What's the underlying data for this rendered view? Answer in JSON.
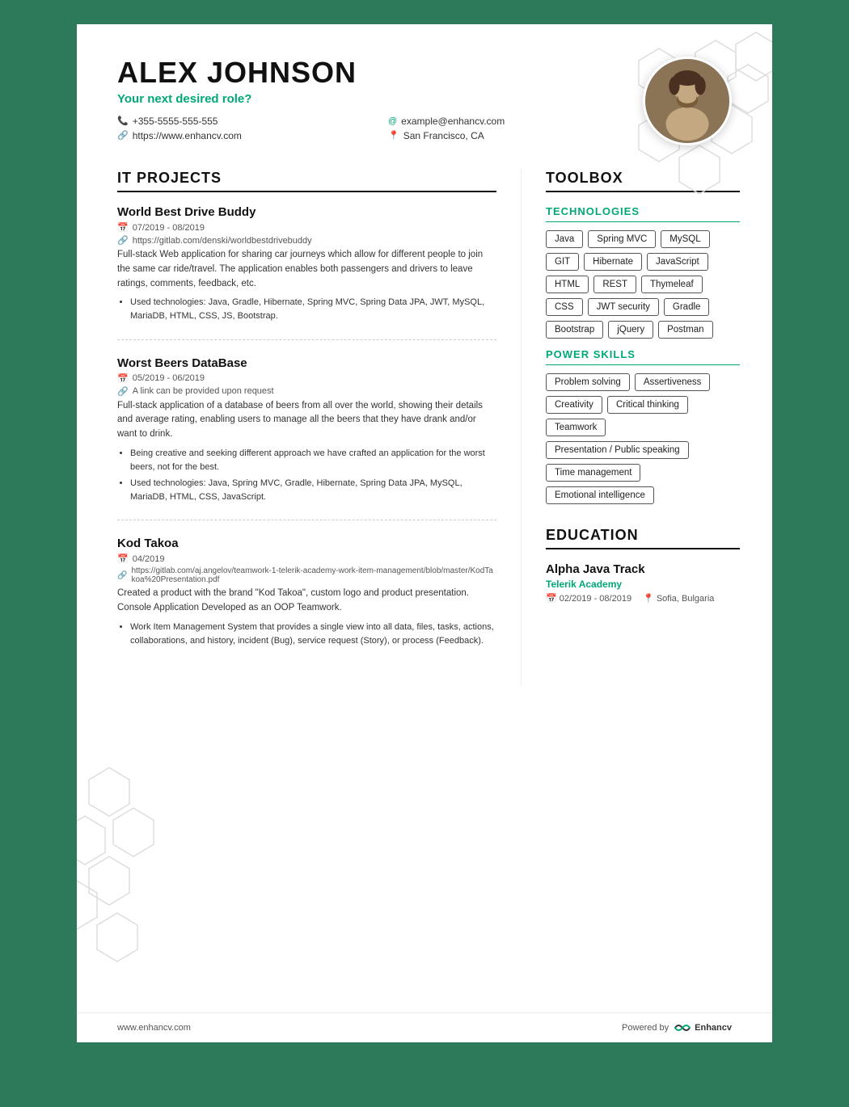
{
  "header": {
    "name": "ALEX JOHNSON",
    "role": "Your next desired role?",
    "phone": "+355-5555-555-555",
    "website": "https://www.enhancv.com",
    "email": "example@enhancv.com",
    "location": "San Francisco, CA"
  },
  "itProjects": {
    "sectionTitle": "IT PROJECTS",
    "projects": [
      {
        "title": "World Best Drive Buddy",
        "dates": "07/2019 - 08/2019",
        "link": "https://gitlab.com/denski/worldbestdrivebuddy",
        "description": "Full-stack Web application for sharing car journeys which allow for different people to join the same car ride/travel. The application enables both passengers and drivers to leave ratings, comments, feedback, etc.",
        "bullets": [
          "Used technologies: Java, Gradle, Hibernate, Spring MVC, Spring Data JPA, JWT, MySQL, MariaDB, HTML, CSS, JS, Bootstrap."
        ]
      },
      {
        "title": "Worst Beers DataBase",
        "dates": "05/2019 - 06/2019",
        "link": "A link can be provided upon request",
        "description": "Full-stack application of a database of beers from all over the world, showing their details and average rating, enabling users to manage all the beers that they have drank and/or want to drink.",
        "bullets": [
          "Being creative and seeking different approach we have crafted an application for the worst beers, not for the best.",
          "Used technologies: Java, Spring MVC, Gradle, Hibernate, Spring Data JPA, MySQL, MariaDB, HTML, CSS, JavaScript."
        ]
      },
      {
        "title": "Kod Takoa",
        "dates": "04/2019",
        "link": "https://gitlab.com/aj.angelov/teamwork-1-telerik-academy-work-item-management/blob/master/KodTakoa%20Presentation.pdf",
        "description": "Created a product with the brand \"Kod Takoa\", custom logo and product presentation. Console Application Developed as an OOP Teamwork.",
        "bullets": [
          "Work Item Management System that provides a single view into all data, files, tasks, actions, collaborations, and history, incident (Bug), service request (Story), or process (Feedback)."
        ]
      }
    ]
  },
  "toolbox": {
    "sectionTitle": "TOOLBOX",
    "technologies": {
      "subTitle": "TECHNOLOGIES",
      "tags": [
        "Java",
        "Spring MVC",
        "MySQL",
        "GIT",
        "Hibernate",
        "JavaScript",
        "HTML",
        "REST",
        "Thymeleaf",
        "CSS",
        "JWT security",
        "Gradle",
        "Bootstrap",
        "jQuery",
        "Postman"
      ]
    },
    "powerSkills": {
      "subTitle": "POWER SKILLS",
      "tags": [
        "Problem solving",
        "Assertiveness",
        "Creativity",
        "Critical thinking",
        "Teamwork",
        "Presentation / Public speaking",
        "Time management",
        "Emotional intelligence"
      ]
    }
  },
  "education": {
    "sectionTitle": "EDUCATION",
    "entries": [
      {
        "degree": "Alpha Java Track",
        "institution": "Telerik Academy",
        "dates": "02/2019 - 08/2019",
        "location": "Sofia, Bulgaria"
      }
    ]
  },
  "footer": {
    "url": "www.enhancv.com",
    "poweredBy": "Powered by",
    "brand": "Enhancv"
  }
}
